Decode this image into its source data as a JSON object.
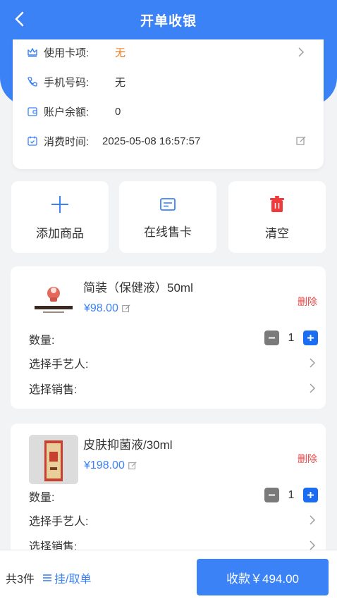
{
  "nav": {
    "title": "开单收银"
  },
  "info": {
    "card_item": {
      "label": "使用卡项:",
      "value": "无"
    },
    "phone": {
      "label": "手机号码:",
      "value": "无"
    },
    "balance": {
      "label": "账户余额:",
      "value": "0"
    },
    "time": {
      "label": "消费时间:",
      "value": "2025-05-08 16:57:57"
    }
  },
  "actions": [
    {
      "label": "添加商品",
      "icon": "plus-icon"
    },
    {
      "label": "在线售卡",
      "icon": "card-icon"
    },
    {
      "label": "清空",
      "icon": "trash-icon"
    }
  ],
  "goods": [
    {
      "name": "简装（保健液）50ml",
      "price": "¥98.00",
      "delete": "删除",
      "qty_label": "数量:",
      "qty": "1",
      "artisan_label": "选择手艺人:",
      "sales_label": "选择销售:"
    },
    {
      "name": "皮肤抑菌液/30ml",
      "price": "¥198.00",
      "delete": "删除",
      "qty_label": "数量:",
      "qty": "1",
      "artisan_label": "选择手艺人:",
      "sales_label": "选择销售:"
    }
  ],
  "bottom": {
    "count": "共3件",
    "hang": "挂/取单",
    "pay": "收款￥494.00"
  },
  "colors": {
    "primary": "#3b82f6",
    "danger": "#ee4444",
    "orange": "#f47c1d"
  }
}
